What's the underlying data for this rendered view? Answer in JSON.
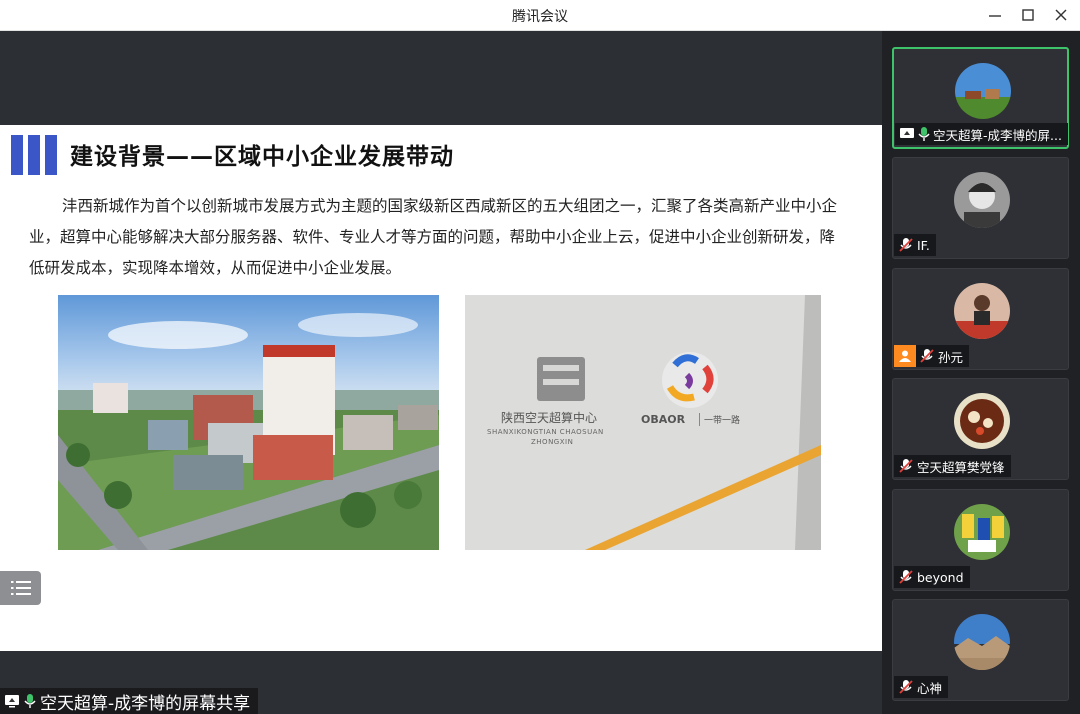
{
  "window": {
    "title": "腾讯会议"
  },
  "slide": {
    "title": "建设背景——区域中小企业发展带动",
    "body": "沣西新城作为首个以创新城市发展方式为主题的国家级新区西咸新区的五大组团之一，汇聚了各类高新产业中小企业，超算中心能够解决大部分服务器、软件、专业人才等方面的问题，帮助中小企业上云，促进中小企业创新研发，降低研发成本，实现降本增效，从而促进中小企业发展。",
    "sign_cn": "陕西空天超算中心",
    "sign_en1": "SHANXIKONGTIAN CHAOSUAN",
    "sign_en2": "ZHONGXIN",
    "sign_logo2": "OBAOR",
    "sign_logo2_cn": "一带一路"
  },
  "share_label": "空天超算-成李博的屏幕共享",
  "participants": [
    {
      "name": "空天超算-成李博的屏...",
      "mic": "on",
      "screen": true,
      "active": true
    },
    {
      "name": "IF.",
      "mic": "muted"
    },
    {
      "name": "孙元",
      "mic": "muted",
      "badge": "orange-user"
    },
    {
      "name": "空天超算樊党锋",
      "mic": "muted"
    },
    {
      "name": "beyond",
      "mic": "muted"
    },
    {
      "name": "心神",
      "mic": "muted"
    }
  ],
  "colors": {
    "accent_green": "#3fc36a",
    "slide_bar": "#3a56c7",
    "badge_orange": "#ff8a1f"
  }
}
